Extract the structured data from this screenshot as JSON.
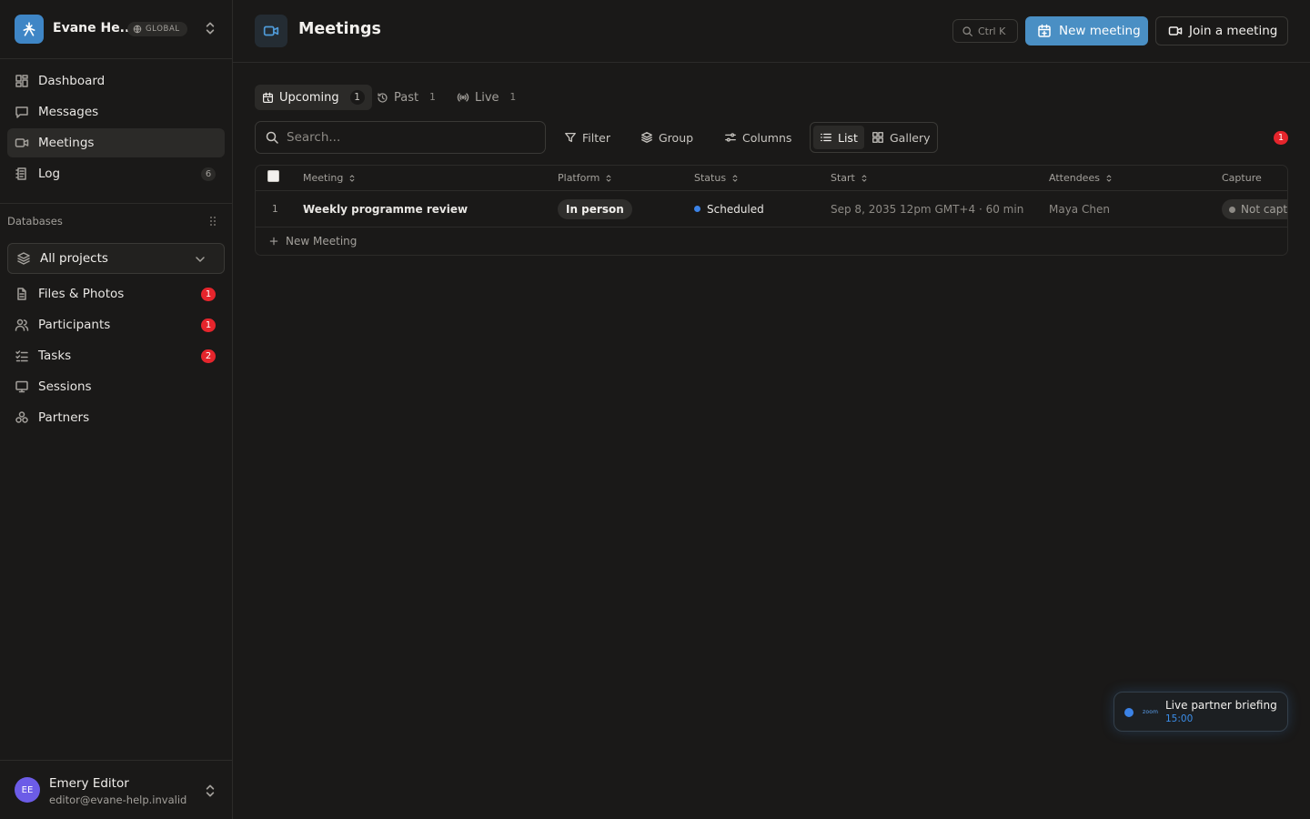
{
  "workspace": {
    "name": "Evane He...",
    "badge": "GLOBAL"
  },
  "nav": {
    "items": [
      {
        "label": "Dashboard",
        "icon": "dashboard-icon"
      },
      {
        "label": "Messages",
        "icon": "message-icon"
      },
      {
        "label": "Meetings",
        "icon": "video-icon",
        "active": true
      },
      {
        "label": "Log",
        "icon": "log-icon",
        "count": "6"
      }
    ]
  },
  "databases": {
    "label": "Databases",
    "project_select": "All projects",
    "items": [
      {
        "label": "Files & Photos",
        "icon": "file-icon",
        "count": "1"
      },
      {
        "label": "Participants",
        "icon": "users-icon",
        "count": "1"
      },
      {
        "label": "Tasks",
        "icon": "tasks-icon",
        "count": "2"
      },
      {
        "label": "Sessions",
        "icon": "presentation-icon"
      },
      {
        "label": "Partners",
        "icon": "partners-icon"
      }
    ]
  },
  "user": {
    "initials": "EE",
    "name": "Emery Editor",
    "email": "editor@evane-help.invalid"
  },
  "header": {
    "title": "Meetings",
    "search_shortcut": "Ctrl K",
    "new_meeting": "New meeting",
    "join_meeting": "Join a meeting"
  },
  "tabs": [
    {
      "label": "Upcoming",
      "count": "1",
      "active": true
    },
    {
      "label": "Past",
      "count": "1"
    },
    {
      "label": "Live",
      "count": "1"
    }
  ],
  "toolbar": {
    "search_placeholder": "Search...",
    "filter": "Filter",
    "group": "Group",
    "columns": "Columns",
    "view_list": "List",
    "view_gallery": "Gallery",
    "alert_count": "1"
  },
  "table": {
    "columns": [
      "Meeting",
      "Platform",
      "Status",
      "Start",
      "Attendees",
      "Capture"
    ],
    "rows": [
      {
        "index": "1",
        "meeting": "Weekly programme review",
        "platform": "In person",
        "status": "Scheduled",
        "start": "Sep 8, 2035 12pm GMT+4",
        "duration": "· 60 min",
        "attendees": "Maya Chen",
        "capture": "Not captured"
      }
    ],
    "add_row": "New Meeting"
  },
  "live_card": {
    "provider": "zoom",
    "title": "Live partner briefing",
    "time": "15:00"
  },
  "colors": {
    "accent": "#4a8fc4",
    "badge_red": "#e5252c",
    "status_blue": "#3b82e6",
    "background": "#1a1918"
  }
}
